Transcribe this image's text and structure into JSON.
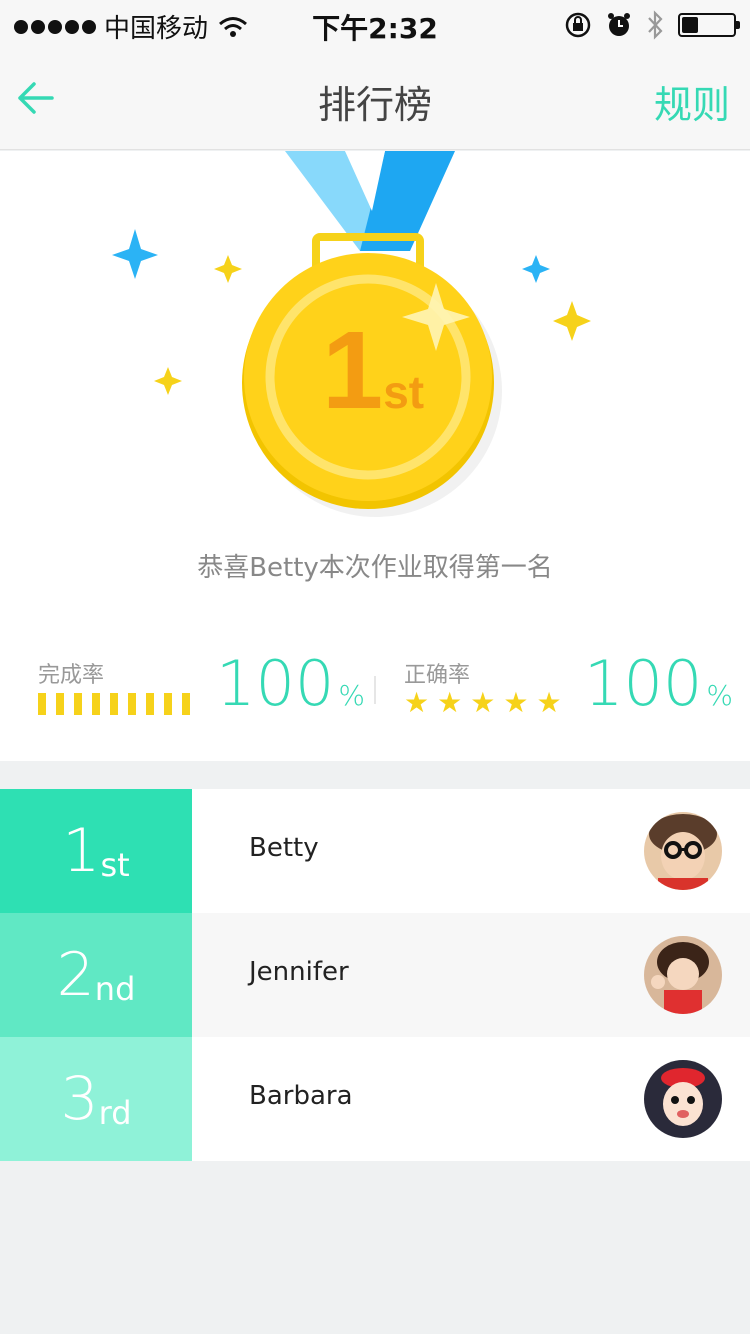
{
  "status_bar": {
    "carrier": "中国移动",
    "time": "下午2:32"
  },
  "nav": {
    "title": "排行榜",
    "rule_label": "规则"
  },
  "medal": {
    "rank_number": "1",
    "rank_suffix": "st"
  },
  "congrats_text": "恭喜Betty本次作业取得第一名",
  "stats": {
    "completion": {
      "label": "完成率",
      "value": "100",
      "unit": "%"
    },
    "accuracy": {
      "label": "正确率",
      "value": "100",
      "unit": "%",
      "stars": 5
    }
  },
  "ranking": [
    {
      "rank": "1",
      "suffix": "st",
      "name": "Betty",
      "color": "#2ee0b3",
      "row_bg": "#ffffff"
    },
    {
      "rank": "2",
      "suffix": "nd",
      "name": "Jennifer",
      "color": "#60e8c4",
      "row_bg": "#f7f7f7"
    },
    {
      "rank": "3",
      "suffix": "rd",
      "name": "Barbara",
      "color": "#8ff2d8",
      "row_bg": "#ffffff"
    }
  ],
  "colors": {
    "accent": "#35d9b4",
    "gold": "#f6d21a",
    "ribbon": "#4fc3f7"
  }
}
